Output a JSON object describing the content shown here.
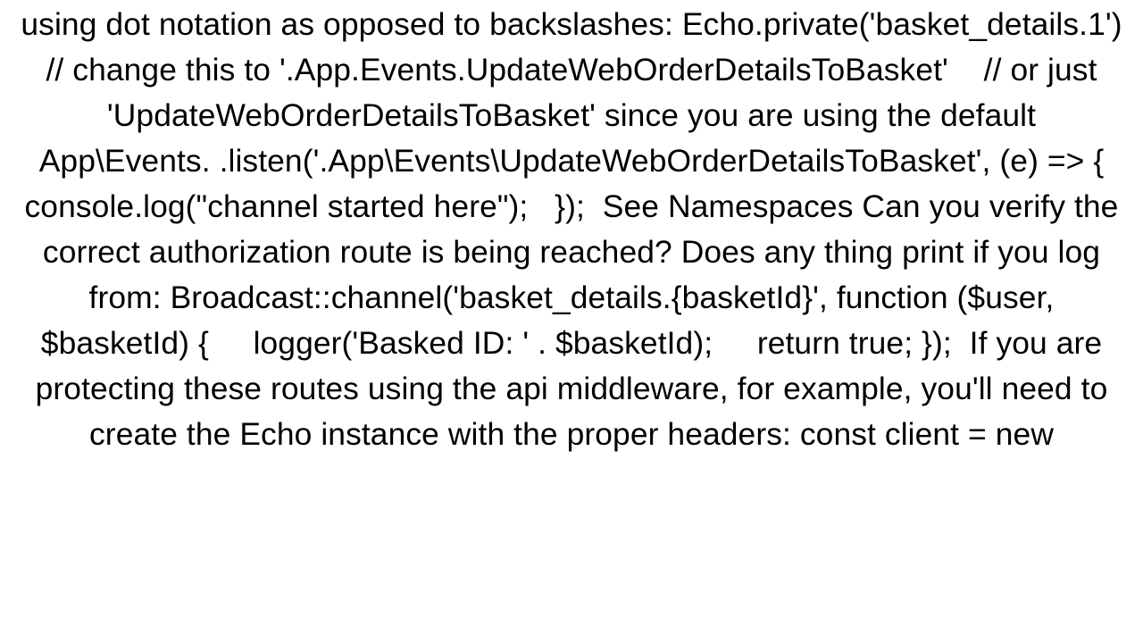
{
  "document": {
    "body_text": "using dot notation as opposed to backslashes: Echo.private('basket_details.1')   // change this to '.App.Events.UpdateWebOrderDetailsToBasket'    // or just 'UpdateWebOrderDetailsToBasket' since you are using the default App\\Events. .listen('.App\\Events\\UpdateWebOrderDetailsToBasket', (e) => {     console.log(\"channel started here\");   });  See Namespaces Can you verify the correct authorization route is being reached? Does any thing print if you log from: Broadcast::channel('basket_details.{basketId}', function ($user, $basketId) {     logger('Basked ID: ' . $basketId);     return true; });  If you are protecting these routes using the api middleware, for example, you'll need to create the Echo instance with the proper headers: const client = new"
  }
}
